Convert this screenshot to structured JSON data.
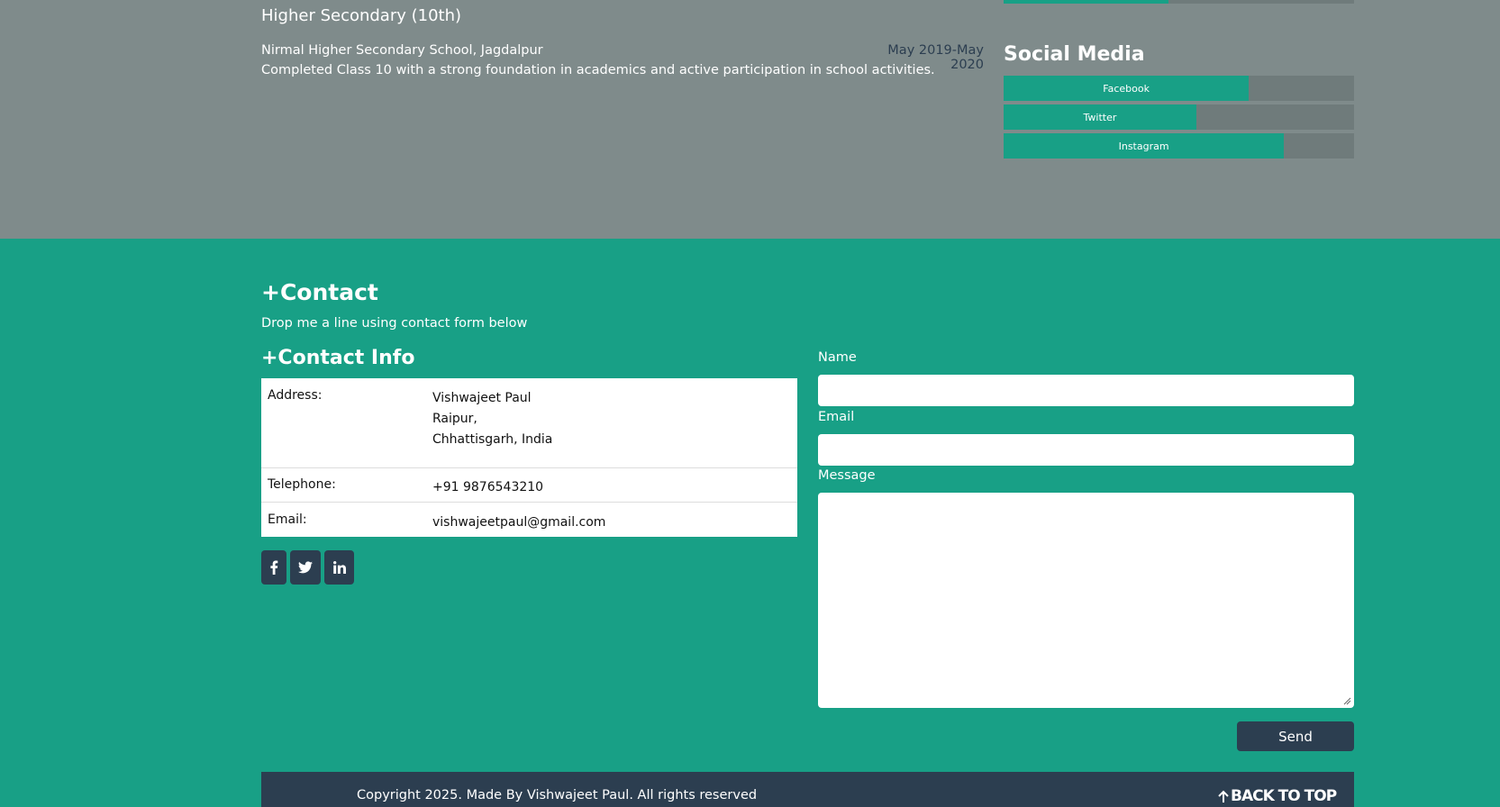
{
  "education": {
    "title": "Higher Secondary (10th)",
    "school": "Nirmal Higher Secondary School, Jagdalpur",
    "date": "May 2019-May 2020",
    "description": "Completed Class 10 with a strong foundation in academics and active participation in school activities."
  },
  "skills_bar_top": {
    "level": 0.47
  },
  "social_media": {
    "title": "Social Media",
    "bars": [
      {
        "label": "Facebook",
        "level": 0.7
      },
      {
        "label": "Twitter",
        "level": 0.55
      },
      {
        "label": "Instagram",
        "level": 0.8
      }
    ]
  },
  "contact": {
    "title": "+Contact",
    "subtitle": "Drop me a line using contact form below",
    "info_title": "+Contact Info",
    "address_label": "Address:",
    "address_lines": [
      "Vishwajeet Paul",
      "Raipur,",
      "Chhattisgarh, India"
    ],
    "telephone_label": "Telephone:",
    "telephone": "+91 9876543210",
    "email_label": "Email:",
    "email": "vishwajeetpaul@gmail.com"
  },
  "social_icons": [
    "facebook-icon",
    "twitter-icon",
    "linkedin-icon"
  ],
  "form": {
    "name_label": "Name",
    "name_value": "",
    "email_label": "Email",
    "email_value": "",
    "message_label": "Message",
    "message_value": "",
    "send_label": "Send"
  },
  "footer": {
    "copyright": "Copyright 2025. Made By Vishwajeet Paul. All rights reserved",
    "back_to_top": "BACK TO TOP"
  },
  "colors": {
    "accent": "#18a086",
    "dark": "#2c3e50",
    "gray": "#7f8b8b"
  }
}
